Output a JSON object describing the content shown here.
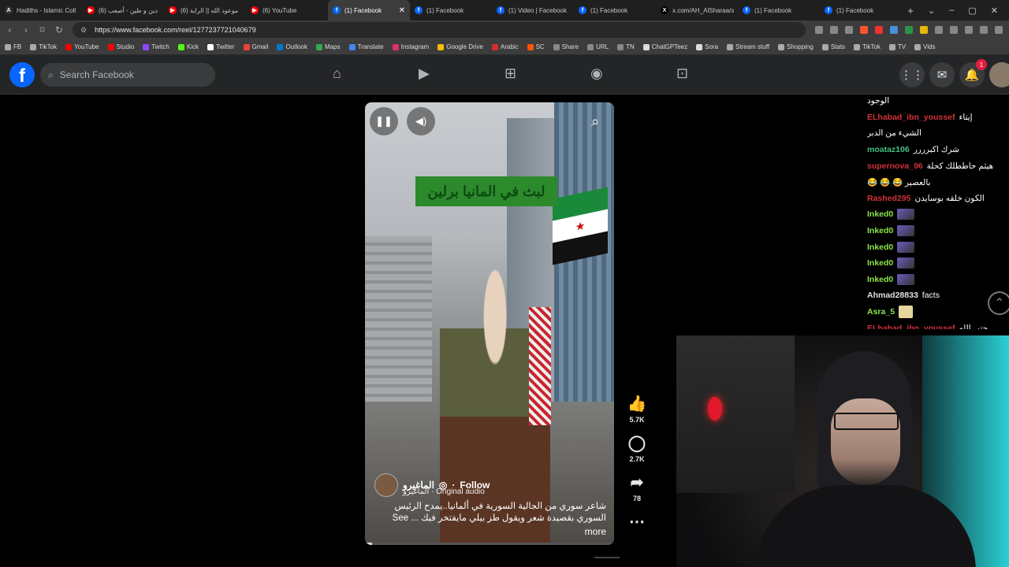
{
  "tabs": [
    {
      "title": "Hadiths - Islamic Coll",
      "fav": "A",
      "color": "#333333"
    },
    {
      "title": "(6) دين و طين - أصعب",
      "fav": "▶",
      "color": "#ff0000"
    },
    {
      "title": "(6) موعود الله || الراية",
      "fav": "▶",
      "color": "#ff0000"
    },
    {
      "title": "(6) YouTube",
      "fav": "▶",
      "color": "#ff0000"
    },
    {
      "title": "(1) Facebook",
      "fav": "f",
      "color": "#0866ff",
      "active": true
    },
    {
      "title": "(1) Facebook",
      "fav": "f",
      "color": "#0866ff"
    },
    {
      "title": "(1) Video | Facebook",
      "fav": "f",
      "color": "#0866ff"
    },
    {
      "title": "(1) Facebook",
      "fav": "f",
      "color": "#0866ff"
    },
    {
      "title": "x.com/AH_AlSharaa/s",
      "fav": "X",
      "color": "#000000"
    },
    {
      "title": "(1) Facebook",
      "fav": "f",
      "color": "#0866ff"
    },
    {
      "title": "(1) Facebook",
      "fav": "f",
      "color": "#0866ff"
    }
  ],
  "address": {
    "url": "https://www.facebook.com/reel/1277237721040679"
  },
  "bookmarks": [
    {
      "label": "FB",
      "color": "#aaaaaa"
    },
    {
      "label": "TikTok",
      "color": "#aaaaaa"
    },
    {
      "label": "YouTube",
      "color": "#ff0000"
    },
    {
      "label": "Studio",
      "color": "#ff0000"
    },
    {
      "label": "Twitch",
      "color": "#9146ff"
    },
    {
      "label": "Kick",
      "color": "#53fc18"
    },
    {
      "label": "Twitter",
      "color": "#ffffff"
    },
    {
      "label": "Gmail",
      "color": "#ea4335"
    },
    {
      "label": "Outlook",
      "color": "#0078d4"
    },
    {
      "label": "Maps",
      "color": "#34a853"
    },
    {
      "label": "Translate",
      "color": "#4285f4"
    },
    {
      "label": "Instagram",
      "color": "#e1306c"
    },
    {
      "label": "Google Drive",
      "color": "#fbbc04"
    },
    {
      "label": "Arabic",
      "color": "#d32f2f"
    },
    {
      "label": "SC",
      "color": "#ff5500"
    },
    {
      "label": "Share",
      "color": "#888888"
    },
    {
      "label": "URL",
      "color": "#888888"
    },
    {
      "label": "TN",
      "color": "#888888"
    },
    {
      "label": "ChatGPTeez",
      "color": "#dddddd"
    },
    {
      "label": "Sora",
      "color": "#dddddd"
    },
    {
      "label": "Stream stuff",
      "color": "#aaaaaa"
    },
    {
      "label": "Shopping",
      "color": "#aaaaaa"
    },
    {
      "label": "Stats",
      "color": "#aaaaaa"
    },
    {
      "label": "TikTok",
      "color": "#aaaaaa"
    },
    {
      "label": "TV",
      "color": "#aaaaaa"
    },
    {
      "label": "Vids",
      "color": "#aaaaaa"
    }
  ],
  "facebook": {
    "search_placeholder": "Search Facebook",
    "notification_count": "1"
  },
  "reel": {
    "banner_text": "لبث في المانيا برلين",
    "author": "الماغيرو",
    "follow_label": "Follow",
    "audio": "الماغيرو · Original audio",
    "caption": "شاعر سوري من الجالية السورية في ألمانيا..يمدح الرئيس السوري بقصيدة شعر ويقول طز بيلي مايفتخر فيك ... See",
    "see_more": "more",
    "progress": 0.03
  },
  "actions": {
    "likes": "5.7K",
    "comments": "2.7K",
    "shares": "78"
  },
  "chat": [
    {
      "user": "",
      "msg": "الوجود",
      "color": "#ffffff"
    },
    {
      "user": "ELhabad_ibn_youssef",
      "msg": "إيتاء",
      "color": "#d13239"
    },
    {
      "user": "",
      "msg": "الشيء من الدبر",
      "color": "#ffffff"
    },
    {
      "user": "moataz106",
      "msg": "شرك اكبرررر",
      "color": "#3fbf7f"
    },
    {
      "user": "supernova_96",
      "msg": "هيثم حاططلك كحلة",
      "color": "#d13239"
    },
    {
      "user": "",
      "msg": "😂 😂 😂 بالعصير",
      "color": "#ffffff"
    },
    {
      "user": "Rashed295",
      "msg": "الكون خلقه بوسايدن",
      "color": "#d13239"
    },
    {
      "user": "Inked0",
      "msg": "",
      "emote": true,
      "color": "#8fe34a"
    },
    {
      "user": "Inked0",
      "msg": "",
      "emote": true,
      "color": "#8fe34a"
    },
    {
      "user": "Inked0",
      "msg": "",
      "emote": true,
      "color": "#8fe34a"
    },
    {
      "user": "Inked0",
      "msg": "",
      "emote": true,
      "color": "#8fe34a"
    },
    {
      "user": "Inked0",
      "msg": "",
      "emote": true,
      "color": "#8fe34a"
    },
    {
      "user": "Ahmad28833",
      "msg": "facts",
      "color": "#e0e0e0"
    },
    {
      "user": "Asra_5",
      "msg": "",
      "emote": true,
      "yellow": true,
      "color": "#8fe34a"
    },
    {
      "user": "ELhabad_ibn_youssef",
      "msg": "حتى الله",
      "color": "#d13239"
    }
  ]
}
